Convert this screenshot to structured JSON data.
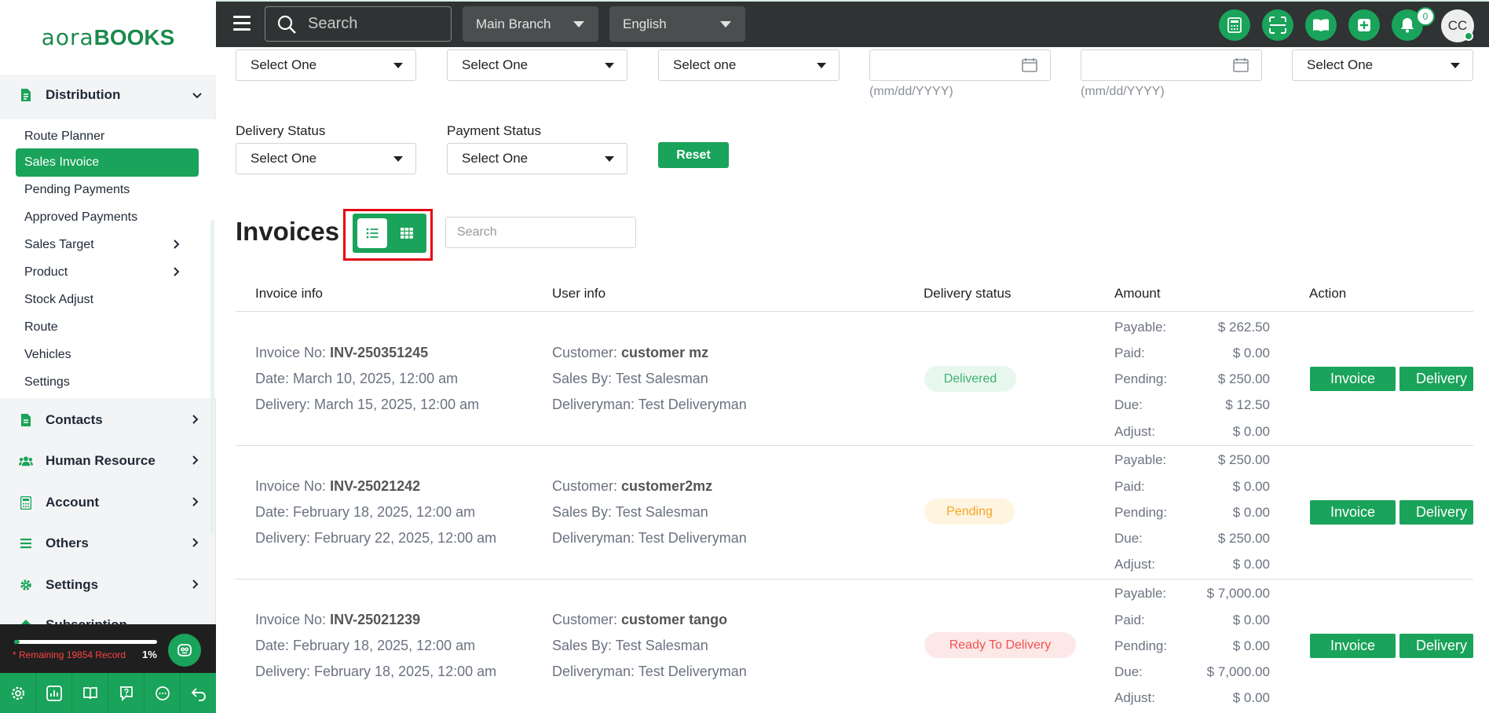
{
  "brand": {
    "logo_a": "aora",
    "logo_b": "BOOKS"
  },
  "sidebar": {
    "distribution": "Distribution",
    "sub": [
      "Route Planner",
      "Sales Invoice",
      "Pending Payments",
      "Approved Payments",
      "Sales Target",
      "Product",
      "Stock Adjust",
      "Route",
      "Vehicles",
      "Settings"
    ],
    "groups": [
      "Contacts",
      "Human Resource",
      "Account",
      "Others",
      "Settings",
      "Subscription"
    ],
    "record_text": "* Remaining 19854 Record",
    "record_pct": "1%",
    "record_progress": 0.01
  },
  "topbar": {
    "search_placeholder": "Search",
    "branch": "Main Branch",
    "language": "English",
    "notif_count": "0",
    "avatar": "CC"
  },
  "filters": {
    "row1": [
      "Select One",
      "Select One",
      "Select one"
    ],
    "last_select": "Select One",
    "date_hint": "(mm/dd/YYYY)",
    "delivery_status_label": "Delivery Status",
    "payment_status_label": "Payment Status",
    "delivery_status_value": "Select One",
    "payment_status_value": "Select One",
    "reset": "Reset"
  },
  "invoices": {
    "title": "Invoices",
    "search_placeholder": "Search",
    "headers": [
      "Invoice info",
      "User info",
      "Delivery status",
      "Amount",
      "Action"
    ],
    "amount_labels": [
      "Payable:",
      "Paid:",
      "Pending:",
      "Due:",
      "Adjust:"
    ],
    "btn_invoice": "Invoice",
    "btn_delivery": "Delivery",
    "rows": [
      {
        "no_label": "Invoice No:",
        "no": "INV-250351245",
        "date": "Date: March 10, 2025, 12:00 am",
        "delivery": "Delivery: March 15, 2025, 12:00 am",
        "customer_label": "Customer:",
        "customer": "customer mz",
        "sales_by": "Sales By: Test Salesman",
        "deliveryman": "Deliveryman: Test Deliveryman",
        "status": "Delivered",
        "amounts": [
          "$ 262.50",
          "$ 0.00",
          "$ 250.00",
          "$ 12.50",
          "$ 0.00"
        ]
      },
      {
        "no_label": "Invoice No:",
        "no": "INV-25021242",
        "date": "Date: February 18, 2025, 12:00 am",
        "delivery": "Delivery: February 22, 2025, 12:00 am",
        "customer_label": "Customer:",
        "customer": "customer2mz",
        "sales_by": "Sales By: Test Salesman",
        "deliveryman": "Deliveryman: Test Deliveryman",
        "status": "Pending",
        "amounts": [
          "$ 250.00",
          "$ 0.00",
          "$ 0.00",
          "$ 250.00",
          "$ 0.00"
        ]
      },
      {
        "no_label": "Invoice No:",
        "no": "INV-25021239",
        "date": "Date: February 18, 2025, 12:00 am",
        "delivery": "Delivery: February 18, 2025, 12:00 am",
        "customer_label": "Customer:",
        "customer": "customer tango",
        "sales_by": "Sales By: Test Salesman",
        "deliveryman": "Deliveryman: Test Deliveryman",
        "status": "Ready To Delivery",
        "amounts": [
          "$ 7,000.00",
          "$ 0.00",
          "$ 0.00",
          "$ 7,000.00",
          "$ 0.00"
        ]
      }
    ]
  },
  "colors": {
    "brand_green": "#1aa35a",
    "topbar": "#2f3334",
    "delivered_bg": "#e8f7ee",
    "delivered_fg": "#3cb371",
    "pending_bg": "#fff4e0",
    "pending_fg": "#f5a623",
    "ready_bg": "#fde8e8",
    "ready_fg": "#ef5350",
    "highlight": "#e30613"
  }
}
